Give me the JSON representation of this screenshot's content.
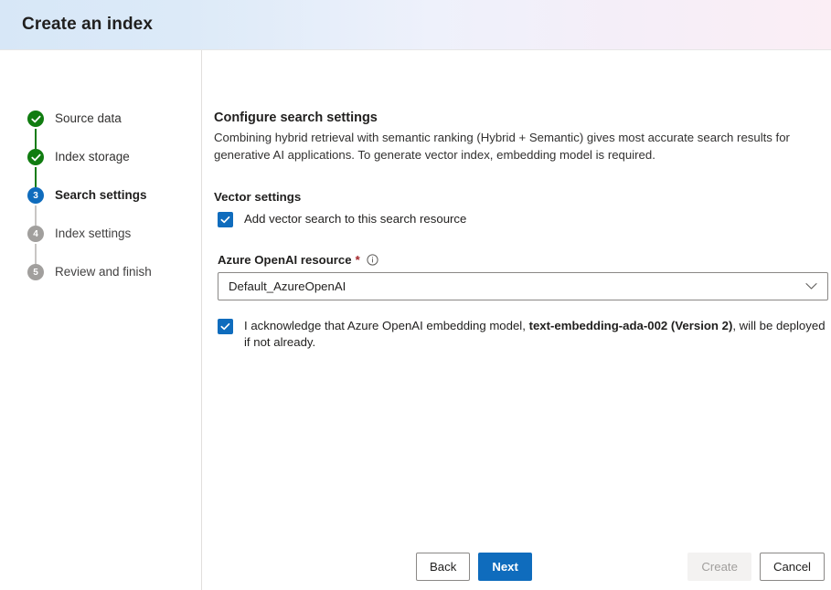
{
  "header": {
    "title": "Create an index",
    "gradient_start": "#d7e7f7",
    "gradient_end": "#fbeef5"
  },
  "sidebar": {
    "steps": [
      {
        "number": "1",
        "label": "Source data",
        "state": "done",
        "icon": "check-circle-icon"
      },
      {
        "number": "2",
        "label": "Index storage",
        "state": "done",
        "icon": "check-circle-icon"
      },
      {
        "number": "3",
        "label": "Search settings",
        "state": "current",
        "icon": "step-number-icon"
      },
      {
        "number": "4",
        "label": "Index settings",
        "state": "todo",
        "icon": "step-number-icon"
      },
      {
        "number": "5",
        "label": "Review and finish",
        "state": "todo",
        "icon": "step-number-icon"
      }
    ],
    "colors": {
      "done": "#107c10",
      "current": "#0f6cbd",
      "todo": "#a19f9d"
    }
  },
  "main": {
    "section_title": "Configure search settings",
    "section_description": "Combining hybrid retrieval with semantic ranking (Hybrid + Semantic) gives most accurate search results for generative AI applications. To generate vector index, embedding model is required.",
    "vector_settings": {
      "group_title": "Vector settings",
      "add_vector_search": {
        "label": "Add vector search to this search resource",
        "checked": true
      }
    },
    "azure_openai_resource": {
      "label": "Azure OpenAI resource",
      "required_marker": "*",
      "info_icon": "info-icon",
      "value": "Default_AzureOpenAI",
      "chevron_icon": "chevron-down-icon"
    },
    "acknowledgement": {
      "checked": true,
      "text_before": "I acknowledge that Azure OpenAI embedding model, ",
      "model_name": "text-embedding-ada-002 (Version 2)",
      "text_after": ", will be deployed if not already."
    }
  },
  "footer": {
    "back_label": "Back",
    "next_label": "Next",
    "create_label": "Create",
    "cancel_label": "Cancel",
    "create_disabled": true,
    "primary_color": "#0f6cbd"
  }
}
